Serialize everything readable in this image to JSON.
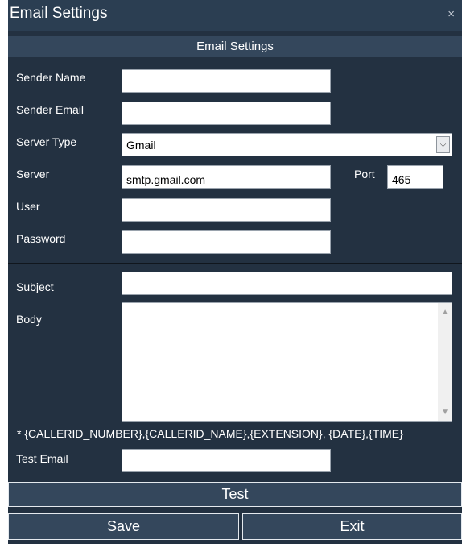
{
  "window": {
    "title": "Email Settings",
    "close_glyph": "×"
  },
  "section_header": "Email Settings",
  "fields": {
    "sender_name": {
      "label": "Sender Name",
      "value": ""
    },
    "sender_email": {
      "label": "Sender Email",
      "value": ""
    },
    "server_type": {
      "label": "Server Type",
      "selected": "Gmail"
    },
    "server": {
      "label": "Server",
      "value": "smtp.gmail.com"
    },
    "port": {
      "label": "Port",
      "value": "465"
    },
    "user": {
      "label": "User",
      "value": ""
    },
    "password": {
      "label": "Password",
      "value": ""
    },
    "subject": {
      "label": "Subject",
      "value": ""
    },
    "body": {
      "label": "Body",
      "value": ""
    },
    "test_email": {
      "label": "Test Email",
      "value": ""
    }
  },
  "placeholders_note": "* {CALLERID_NUMBER},{CALLERID_NAME},{EXTENSION}, {DATE},{TIME}",
  "buttons": {
    "test": "Test",
    "save": "Save",
    "exit": "Exit"
  },
  "icons": {
    "close": "close-icon",
    "dropdown": "chevron-down-icon",
    "scroll_up": "chevron-up-icon",
    "scroll_down": "chevron-down-icon"
  },
  "colors": {
    "background": "#233141",
    "titlebar": "#2b3e52",
    "header": "#34475c",
    "button": "#34475c"
  }
}
